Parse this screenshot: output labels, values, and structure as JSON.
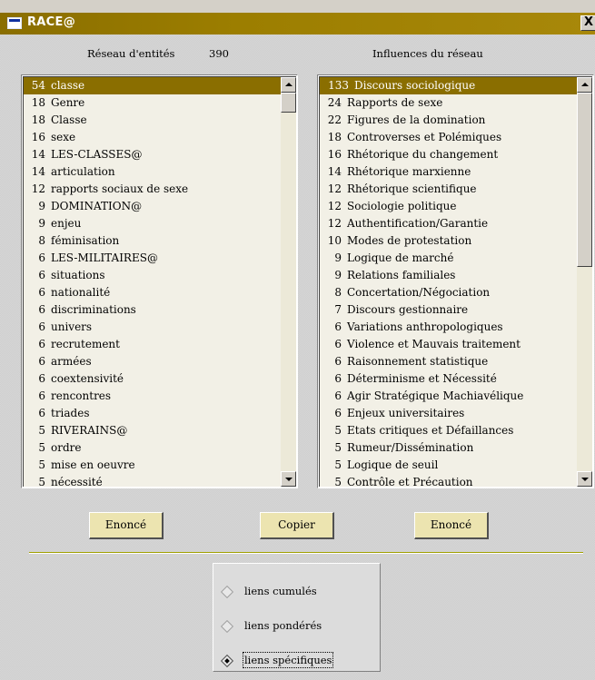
{
  "window": {
    "title": "RACE@",
    "close_label": "X"
  },
  "left_panel": {
    "header_label": "Réseau d'entités",
    "header_count": "390",
    "items": [
      {
        "n": "54",
        "label": "classe"
      },
      {
        "n": "18",
        "label": "Genre"
      },
      {
        "n": "18",
        "label": "Classe"
      },
      {
        "n": "16",
        "label": "sexe"
      },
      {
        "n": "14",
        "label": "LES-CLASSES@"
      },
      {
        "n": "14",
        "label": "articulation"
      },
      {
        "n": "12",
        "label": "rapports sociaux de sexe"
      },
      {
        "n": "9",
        "label": "DOMINATION@"
      },
      {
        "n": "9",
        "label": "enjeu"
      },
      {
        "n": "8",
        "label": "féminisation"
      },
      {
        "n": "6",
        "label": "LES-MILITAIRES@"
      },
      {
        "n": "6",
        "label": "situations"
      },
      {
        "n": "6",
        "label": "nationalité"
      },
      {
        "n": "6",
        "label": "discriminations"
      },
      {
        "n": "6",
        "label": "univers"
      },
      {
        "n": "6",
        "label": "recrutement"
      },
      {
        "n": "6",
        "label": "armées"
      },
      {
        "n": "6",
        "label": "coextensivité"
      },
      {
        "n": "6",
        "label": "rencontres"
      },
      {
        "n": "6",
        "label": "triades"
      },
      {
        "n": "5",
        "label": "RIVERAINS@"
      },
      {
        "n": "5",
        "label": "ordre"
      },
      {
        "n": "5",
        "label": "mise en oeuvre"
      },
      {
        "n": "5",
        "label": "nécessité"
      }
    ]
  },
  "right_panel": {
    "header_label": "Influences du réseau",
    "items": [
      {
        "n": "133",
        "label": "Discours sociologique"
      },
      {
        "n": "24",
        "label": "Rapports de sexe"
      },
      {
        "n": "22",
        "label": "Figures de la domination"
      },
      {
        "n": "18",
        "label": "Controverses et Polémiques"
      },
      {
        "n": "16",
        "label": "Rhétorique du changement"
      },
      {
        "n": "14",
        "label": "Rhétorique marxienne"
      },
      {
        "n": "12",
        "label": "Rhétorique scientifique"
      },
      {
        "n": "12",
        "label": "Sociologie politique"
      },
      {
        "n": "12",
        "label": "Authentification/Garantie"
      },
      {
        "n": "10",
        "label": "Modes de protestation"
      },
      {
        "n": "9",
        "label": "Logique de marché"
      },
      {
        "n": "9",
        "label": "Relations familiales"
      },
      {
        "n": "8",
        "label": "Concertation/Négociation"
      },
      {
        "n": "7",
        "label": "Discours gestionnaire"
      },
      {
        "n": "6",
        "label": "Variations anthropologiques"
      },
      {
        "n": "6",
        "label": "Violence et Mauvais traitement"
      },
      {
        "n": "6",
        "label": "Raisonnement statistique"
      },
      {
        "n": "6",
        "label": "Déterminisme et Nécessité"
      },
      {
        "n": "6",
        "label": "Agir Stratégique Machiavélique"
      },
      {
        "n": "6",
        "label": "Enjeux universitaires"
      },
      {
        "n": "5",
        "label": "Etats critiques et Défaillances"
      },
      {
        "n": "5",
        "label": "Rumeur/Dissémination"
      },
      {
        "n": "5",
        "label": "Logique de seuil"
      },
      {
        "n": "5",
        "label": "Contrôle et Précaution"
      }
    ]
  },
  "buttons": {
    "enonce_left": "Enoncé",
    "copier": "Copier",
    "enonce_right": "Enoncé"
  },
  "options": [
    {
      "label": "liens cumulés",
      "selected": false
    },
    {
      "label": "liens pondérés",
      "selected": false
    },
    {
      "label": "liens spécifiques",
      "selected": true
    }
  ],
  "colors": {
    "accent": "#8a6e00",
    "button_face": "#ece4b0",
    "list_background": "#f2f0e6"
  }
}
